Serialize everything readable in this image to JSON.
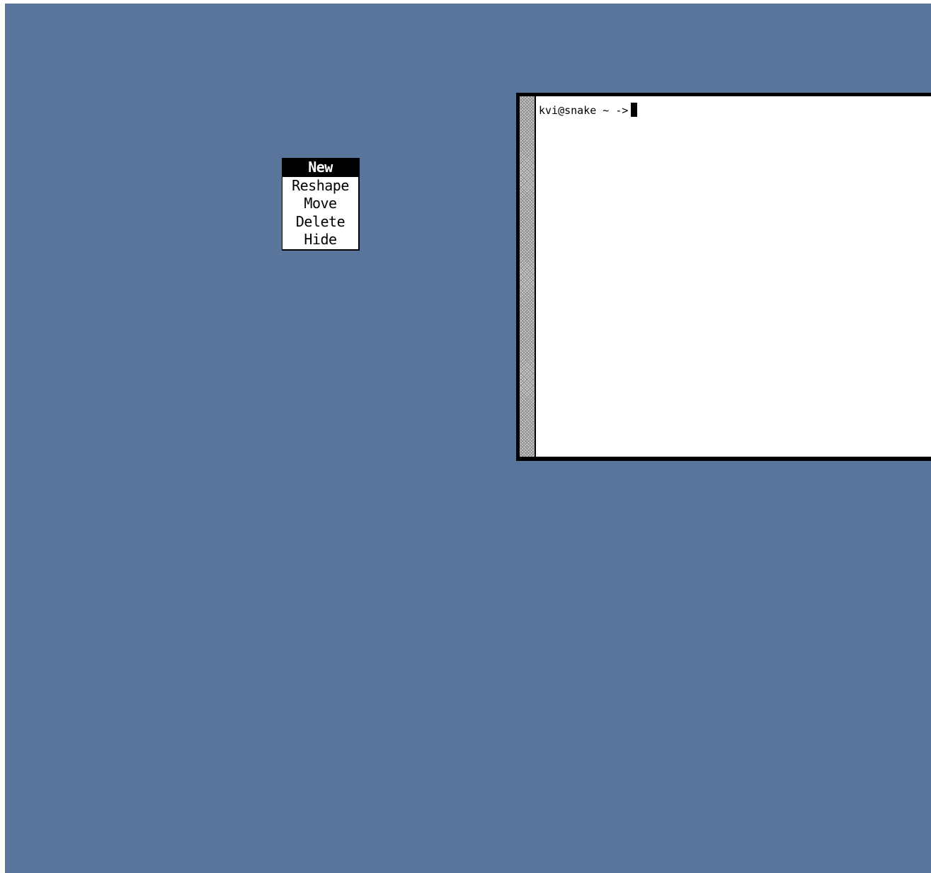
{
  "desktop": {
    "background_color": "#5a759c"
  },
  "wm_menu": {
    "items": [
      {
        "label": "New",
        "selected": true
      },
      {
        "label": "Reshape",
        "selected": false
      },
      {
        "label": "Move",
        "selected": false
      },
      {
        "label": "Delete",
        "selected": false
      },
      {
        "label": "Hide",
        "selected": false
      }
    ]
  },
  "terminal": {
    "prompt": "kvi@snake ~ ->"
  }
}
